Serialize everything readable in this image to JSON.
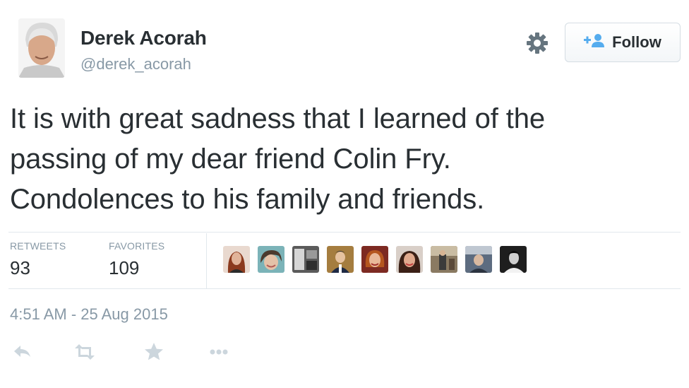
{
  "user": {
    "display_name": "Derek Acorah",
    "screen_name": "@derek_acorah",
    "avatar_icon": "profile-photo"
  },
  "header": {
    "settings_icon": "gear-icon",
    "follow_icon": "follow-plus-person-icon",
    "follow_label": "Follow"
  },
  "tweet": {
    "line1": "It is with great sadness that I learned of the",
    "line2": "passing of my dear friend Colin Fry.",
    "line3": "Condolences to his family and friends."
  },
  "stats": {
    "retweets_label": "RETWEETS",
    "retweets_value": "93",
    "favorites_label": "FAVORITES",
    "favorites_value": "109"
  },
  "favoriters": {
    "count_shown": 9
  },
  "meta": {
    "timestamp": "4:51 AM - 25 Aug 2015"
  },
  "actions": {
    "icons": [
      "reply-icon",
      "retweet-icon",
      "favorite-star-icon",
      "more-dots-icon"
    ]
  },
  "colors": {
    "text": "#292f33",
    "muted": "#8899a6",
    "divider": "#e1e8ed",
    "follow_icon": "#55acee",
    "action_icon": "#ccd6dd"
  }
}
